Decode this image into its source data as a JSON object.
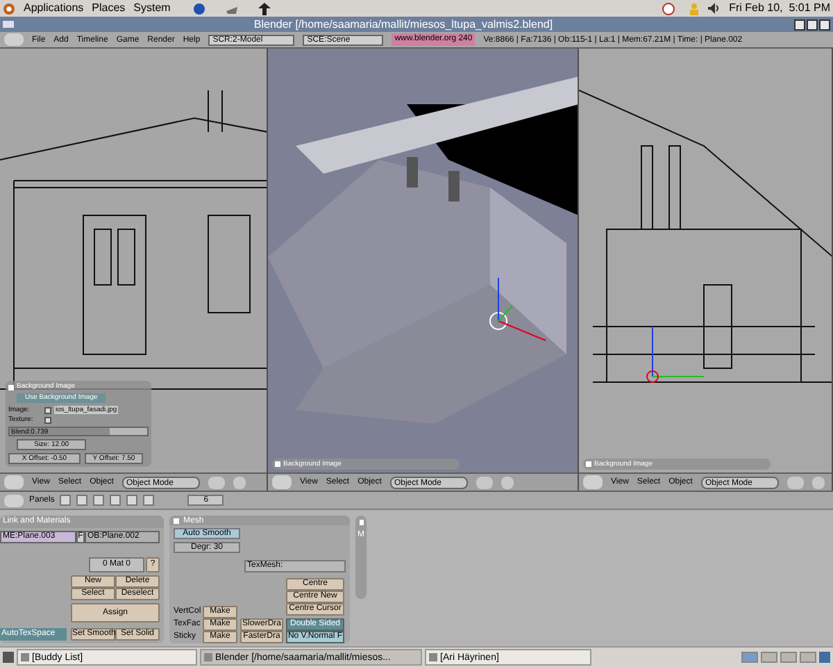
{
  "top_panel": {
    "menus": [
      "Applications",
      "Places",
      "System"
    ],
    "clock": "Fri Feb 10,  5:01 PM"
  },
  "window": {
    "title": "Blender [/home/saamaria/mallit/miesos_ltupa_valmis2.blend]"
  },
  "info_header": {
    "menus": [
      "File",
      "Add",
      "Timeline",
      "Game",
      "Render",
      "Help"
    ],
    "screen": "SCR:2-Model",
    "scene": "SCE:Scene",
    "link": "www.blender.org 240",
    "stats": "Ve:8866 | Fa:7136 | Ob:115-1 | La:1 | Mem:67.21M | Time: | Plane.002"
  },
  "viewports": [
    {
      "kind": "facade",
      "panel": {
        "title": "Background Image",
        "expanded": true,
        "use_button": "Use Background Image",
        "image_label": "Image:",
        "image_file": "ios_ltupa_fasadi.jpg",
        "texture_label": "Texture:",
        "blend": "Blend:0.739",
        "level": 0.73,
        "size": "Size: 12.00",
        "x_offset": "X Offset: -0.50",
        "y_offset": "Y Offset: 7.50"
      },
      "header": {
        "menus": [
          "View",
          "Select",
          "Object"
        ],
        "mode": "Object Mode"
      }
    },
    {
      "kind": "model",
      "panel": {
        "title": "Background Image",
        "expanded": false
      },
      "header": {
        "menus": [
          "View",
          "Select",
          "Object"
        ],
        "mode": "Object Mode"
      }
    },
    {
      "kind": "elevation",
      "panel": {
        "title": "Background Image",
        "expanded": false
      },
      "header": {
        "menus": [
          "View",
          "Select",
          "Object"
        ],
        "mode": "Object Mode"
      }
    }
  ],
  "buttons_window": {
    "header": {
      "label": "Panels",
      "value": "6"
    },
    "link_panel": {
      "title": "Link and Materials",
      "mesh_name": "ME:Plane.003",
      "f": "F",
      "object_name": "OB:Plane.002",
      "material": "0 Mat 0",
      "help": "?",
      "buttons": [
        "New",
        "Delete",
        "Select",
        "Deselect"
      ],
      "assign": "Assign",
      "auto_tex_space": {
        "label": "AutoTexSpace",
        "on": true
      },
      "set_smooth": "Set Smooth",
      "set_solid": "Set Solid"
    },
    "mesh_panel": {
      "title": "Mesh",
      "auto_smooth": {
        "label": "Auto Smooth",
        "on": false
      },
      "degree": "Degr: 30",
      "tex_mesh": "TexMesh:",
      "centre_buttons": [
        "Centre",
        "Centre New",
        "Centre Cursor"
      ],
      "make_rows": [
        {
          "label": "VertCol",
          "button": "Make"
        },
        {
          "label": "TexFac",
          "button": "Make"
        },
        {
          "label": "Sticky",
          "button": "Make"
        }
      ],
      "draw_buttons": [
        "SlowerDra",
        "FasterDra"
      ],
      "toggles": [
        {
          "label": "Double Sided",
          "on": true
        },
        {
          "label": "No V.Normal F",
          "on": false
        }
      ]
    },
    "side_tab": "M"
  },
  "taskbar": [
    {
      "label": "[Buddy List]",
      "selected": false
    },
    {
      "label": "Blender [/home/saamaria/mallit/miesos...",
      "selected": true
    },
    {
      "label": "[Ari Häyrinen]",
      "selected": false
    }
  ]
}
